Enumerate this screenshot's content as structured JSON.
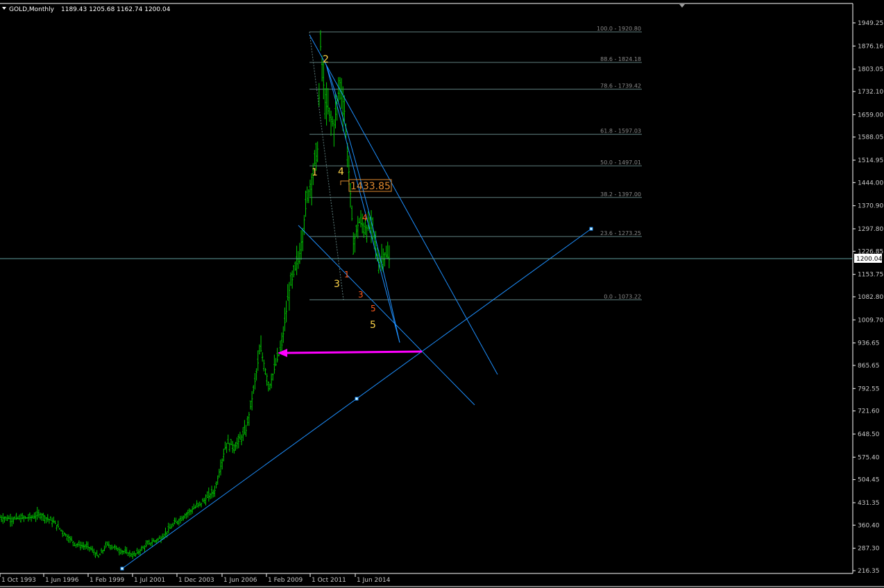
{
  "header": {
    "symbol_timeframe": "GOLD,Monthly",
    "ohlc": "1189.43 1205.68 1162.74 1200.04"
  },
  "current_price_label": "1200.04",
  "colors": {
    "background": "#000000",
    "candle": "#00cc00",
    "grid_axis": "#ffffff",
    "trendline": "#1e90ff",
    "fib": "#5f7f7f",
    "arrow": "#ff00ff",
    "wave_major": "#ffd54a",
    "wave_minor": "#ff5a1e",
    "price_tag": "#e08a2e"
  },
  "chart_data": {
    "type": "candlestick",
    "ylim": [
      216.35,
      1949.25
    ],
    "y_ticks": [
      "1949.25",
      "1876.16",
      "1803.05",
      "1732.10",
      "1659.00",
      "1588.05",
      "1514.95",
      "1444.00",
      "1370.90",
      "1297.80",
      "1226.85",
      "1153.75",
      "1082.80",
      "1009.70",
      "936.65",
      "865.65",
      "792.55",
      "721.60",
      "648.50",
      "575.40",
      "504.45",
      "431.35",
      "360.40",
      "287.30",
      "216.35"
    ],
    "x_ticks": [
      "1 Oct 1993",
      "1 Jun 1996",
      "1 Feb 1999",
      "1 Jul 2001",
      "1 Dec 2003",
      "1 Jun 2006",
      "1 Feb 2009",
      "1 Oct 2011",
      "1 Jun 2014"
    ],
    "fib_levels": [
      {
        "label": "100.0 - 1920.80",
        "value": 1920.8
      },
      {
        "label": "88.6 - 1824.18",
        "value": 1824.18
      },
      {
        "label": "78.6 - 1739.42",
        "value": 1739.42
      },
      {
        "label": "61.8 - 1597.03",
        "value": 1597.03
      },
      {
        "label": "50.0 - 1497.01",
        "value": 1497.01
      },
      {
        "label": "38.2 - 1397.00",
        "value": 1397.0
      },
      {
        "label": "23.6 - 1273.25",
        "value": 1273.25
      },
      {
        "label": "0.0 - 1073.22",
        "value": 1073.22
      }
    ],
    "price_anchor": [
      [
        1993.75,
        385
      ],
      [
        1994.5,
        380
      ],
      [
        1995.5,
        385
      ],
      [
        1996.0,
        395
      ],
      [
        1996.75,
        370
      ],
      [
        1997.5,
        325
      ],
      [
        1998.0,
        300
      ],
      [
        1998.75,
        290
      ],
      [
        1999.25,
        260
      ],
      [
        1999.75,
        300
      ],
      [
        2000.5,
        280
      ],
      [
        2001.25,
        265
      ],
      [
        2002.0,
        300
      ],
      [
        2002.75,
        320
      ],
      [
        2003.5,
        365
      ],
      [
        2004.25,
        400
      ],
      [
        2005.0,
        430
      ],
      [
        2005.75,
        470
      ],
      [
        2006.4,
        620
      ],
      [
        2006.9,
        610
      ],
      [
        2007.5,
        660
      ],
      [
        2007.9,
        780
      ],
      [
        2008.3,
        920
      ],
      [
        2008.8,
        800
      ],
      [
        2009.5,
        930
      ],
      [
        2009.9,
        1100
      ],
      [
        2010.5,
        1220
      ],
      [
        2010.9,
        1390
      ],
      [
        2011.5,
        1550
      ],
      [
        2011.67,
        1880
      ],
      [
        2011.9,
        1700
      ],
      [
        2012.4,
        1620
      ],
      [
        2012.75,
        1760
      ],
      [
        2013.0,
        1670
      ],
      [
        2013.3,
        1440
      ],
      [
        2013.5,
        1250
      ],
      [
        2013.8,
        1320
      ],
      [
        2014.2,
        1300
      ],
      [
        2014.6,
        1300
      ],
      [
        2014.9,
        1190
      ],
      [
        2015.2,
        1220
      ],
      [
        2015.5,
        1200
      ]
    ],
    "annotations": {
      "price_tag": "1433.85",
      "wave_major": [
        "1",
        "2",
        "3",
        "4",
        "5"
      ],
      "wave_minor": [
        "1",
        "3",
        "4",
        "5"
      ]
    }
  }
}
